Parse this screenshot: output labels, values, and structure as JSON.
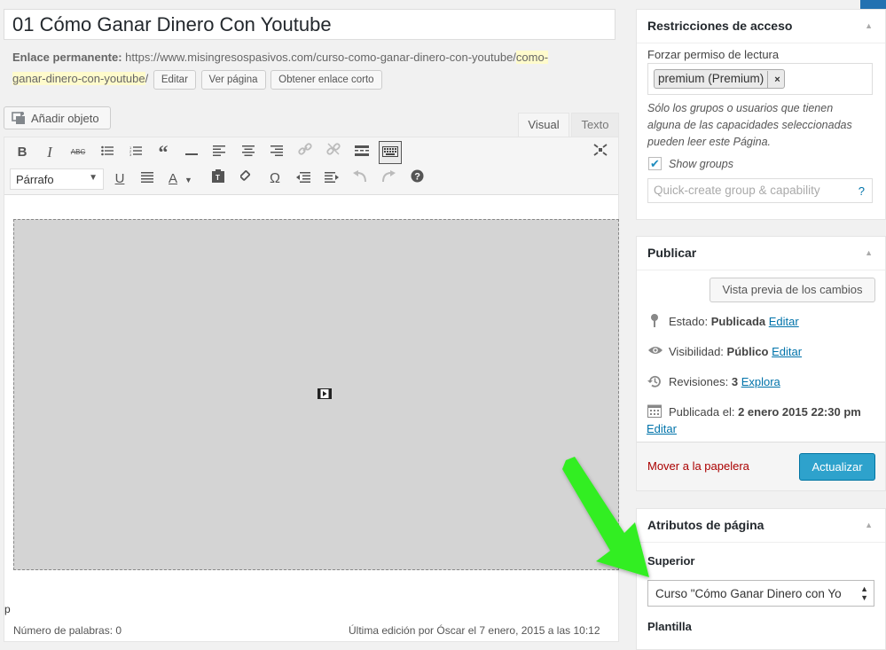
{
  "title": "01 Cómo Ganar Dinero Con Youtube",
  "permalink": {
    "label": "Enlace permanente:",
    "url_base": "https://www.misingresospasivos.com/curso-como-ganar-dinero-con-youtube/",
    "slug_part1": "como-",
    "slug_part2": "ganar-dinero-con-youtube",
    "trailing": "/",
    "edit_button": "Editar",
    "view_button": "Ver página",
    "shortlink_button": "Obtener enlace corto"
  },
  "editor": {
    "add_media": "Añadir objeto",
    "tab_visual": "Visual",
    "tab_text": "Texto",
    "format_select": "Párrafo",
    "path": "p",
    "word_count": "Número de palabras: 0",
    "last_edit": "Última edición por Óscar el 7 enero, 2015 a las 10:12"
  },
  "access_panel": {
    "title": "Restricciones de acceso",
    "read_label": "Forzar permiso de lectura",
    "chip": "premium (Premium)",
    "chip_remove": "×",
    "help_line1": "Sólo los grupos o usuarios que tienen",
    "help_line2": "alguna de las capacidades seleccionadas",
    "help_line3": "pueden leer este Página.",
    "show_groups": "Show groups",
    "quick_create_placeholder": "Quick-create group & capability",
    "help_icon": "?"
  },
  "publish_panel": {
    "title": "Publicar",
    "preview_button": "Vista previa de los cambios",
    "status_label": "Estado:",
    "status_value": "Publicada",
    "visibility_label": "Visibilidad:",
    "visibility_value": "Público",
    "revisions_label": "Revisiones:",
    "revisions_value": "3",
    "explore_link": "Explora",
    "published_label": "Publicada el:",
    "published_value": "2 enero 2015 22:30 pm",
    "edit_link": "Editar",
    "trash_link": "Mover a la papelera",
    "update_button": "Actualizar"
  },
  "attributes_panel": {
    "title": "Atributos de página",
    "parent_label": "Superior",
    "parent_value": "Curso \"Cómo Ganar Dinero con Yo",
    "template_label": "Plantilla"
  },
  "colors": {
    "arrow": "#33ee22",
    "primary_button": "#2ea2cc",
    "link": "#0073aa",
    "trash": "#aa0000"
  }
}
